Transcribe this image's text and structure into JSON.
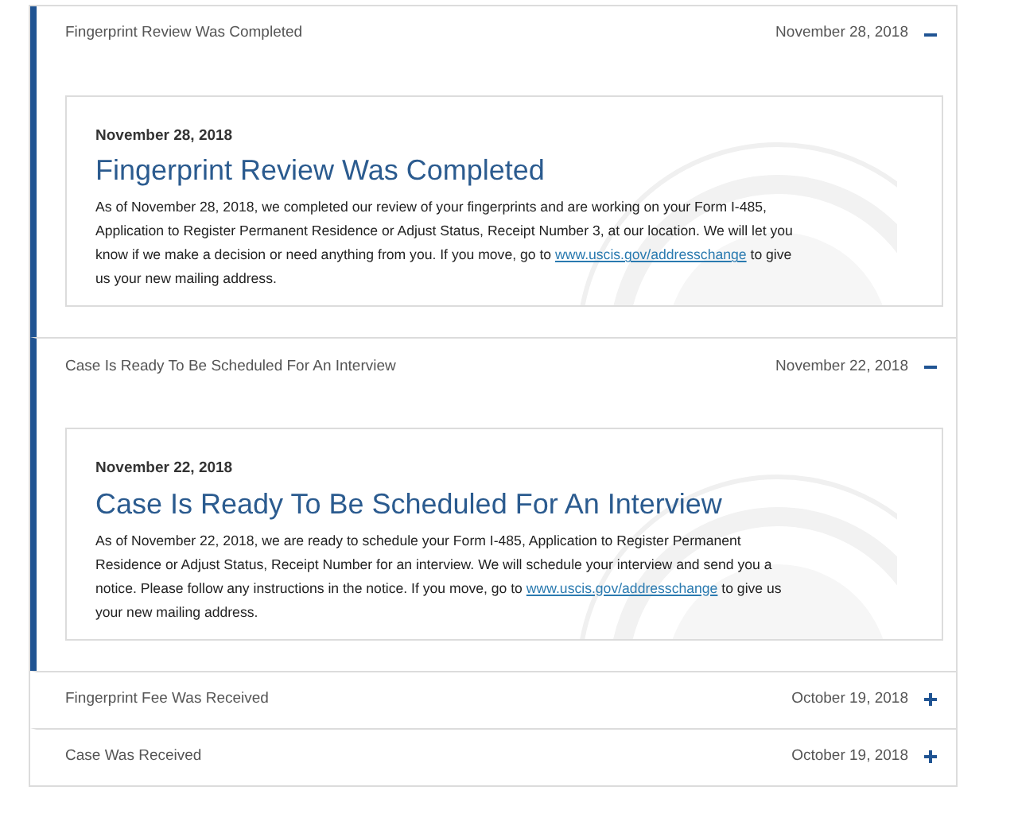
{
  "items": [
    {
      "title": "Fingerprint Review Was Completed",
      "date": "November 28, 2018",
      "expanded": true,
      "body": {
        "date": "November 28, 2018",
        "heading": "Fingerprint Review Was Completed",
        "text_before": "As of November 28, 2018, we completed our review of your fingerprints and are working on your Form I-485, Application to Register Permanent Residence or Adjust Status, Receipt Number 3, at our location. We will let you know if we make a decision or need anything from you. If you move, go to",
        "link": "www.uscis.gov/addresschange",
        "text_after": "to give us your new mailing address."
      }
    },
    {
      "title": "Case Is Ready To Be Scheduled For An Interview",
      "date": "November 22, 2018",
      "expanded": true,
      "body": {
        "date": "November 22, 2018",
        "heading": "Case Is Ready To Be Scheduled For An Interview",
        "text_before": "As of November 22, 2018, we are ready to schedule your Form I-485, Application to Register Permanent Residence or Adjust Status, Receipt Number for an interview. We will schedule your interview and send you a notice. Please follow any instructions in the notice. If you move, go to",
        "link": "www.uscis.gov/addresschange",
        "text_after": "to give us your new mailing address."
      }
    },
    {
      "title": "Fingerprint Fee Was Received",
      "date": "October 19, 2018",
      "expanded": false
    },
    {
      "title": "Case Was Received",
      "date": "October 19, 2018",
      "expanded": false
    }
  ]
}
